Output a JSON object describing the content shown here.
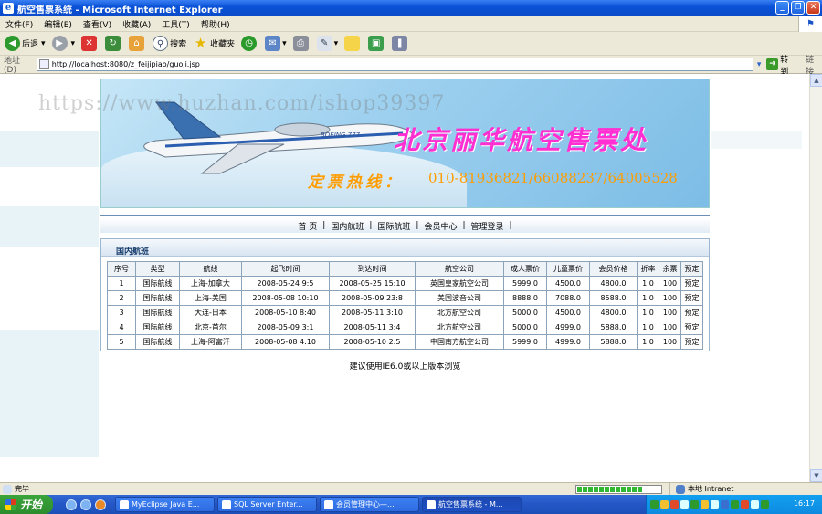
{
  "window": {
    "title": "航空售票系统 - Microsoft Internet Explorer",
    "min": "_",
    "max": "❐",
    "close": "✕"
  },
  "menu": [
    "文件(F)",
    "编辑(E)",
    "查看(V)",
    "收藏(A)",
    "工具(T)",
    "帮助(H)"
  ],
  "toolbar": {
    "back": "后退",
    "search": "搜索",
    "favorites": "收藏夹"
  },
  "address": {
    "label": "地址(D)",
    "url": "http://localhost:8080/z_feijipiao/guoji.jsp",
    "go": "转到",
    "links": "链接"
  },
  "banner": {
    "title": "北京丽华航空售票处",
    "hotline_label": "定票热线：",
    "phones": "010-81936821/66088237/64005528",
    "plane_text": "BOEING 777"
  },
  "watermark": "https://www.huzhan.com/ishop39397",
  "nav": [
    "首 页",
    "国内航班",
    "国际航班",
    "会员中心",
    "管理登录"
  ],
  "panel": {
    "title": "国内航班"
  },
  "table": {
    "headers": [
      "序号",
      "类型",
      "航线",
      "起飞时间",
      "到达时间",
      "航空公司",
      "成人票价",
      "儿童票价",
      "会员价格",
      "折率",
      "余票",
      "预定"
    ],
    "rows": [
      [
        "1",
        "国际航线",
        "上海-加拿大",
        "2008-05-24 9:5",
        "2008-05-25 15:10",
        "英国皇家航空公司",
        "5999.0",
        "4500.0",
        "4800.0",
        "1.0",
        "100",
        "预定"
      ],
      [
        "2",
        "国际航线",
        "上海-美国",
        "2008-05-08 10:10",
        "2008-05-09 23:8",
        "美国波音公司",
        "8888.0",
        "7088.0",
        "8588.0",
        "1.0",
        "100",
        "预定"
      ],
      [
        "3",
        "国际航线",
        "大连-日本",
        "2008-05-10 8:40",
        "2008-05-11 3:10",
        "北方航空公司",
        "5000.0",
        "4500.0",
        "4800.0",
        "1.0",
        "100",
        "预定"
      ],
      [
        "4",
        "国际航线",
        "北京-首尔",
        "2008-05-09 3:1",
        "2008-05-11 3:4",
        "北方航空公司",
        "5000.0",
        "4999.0",
        "5888.0",
        "1.0",
        "100",
        "预定"
      ],
      [
        "5",
        "国际航线",
        "上海-阿富汗",
        "2008-05-08 4:10",
        "2008-05-10 2:5",
        "中国南方航空公司",
        "5999.0",
        "4999.0",
        "5888.0",
        "1.0",
        "100",
        "预定"
      ]
    ]
  },
  "footnote": "建议使用IE6.0或以上版本浏览",
  "status": {
    "done": "完毕",
    "zone": "本地 Intranet"
  },
  "taskbar": {
    "start": "开始",
    "tasks": [
      "MyEclipse Java E...",
      "SQL Server Enter...",
      "会员管理中心—...",
      "航空售票系统 - M..."
    ],
    "clock": "16:17"
  }
}
